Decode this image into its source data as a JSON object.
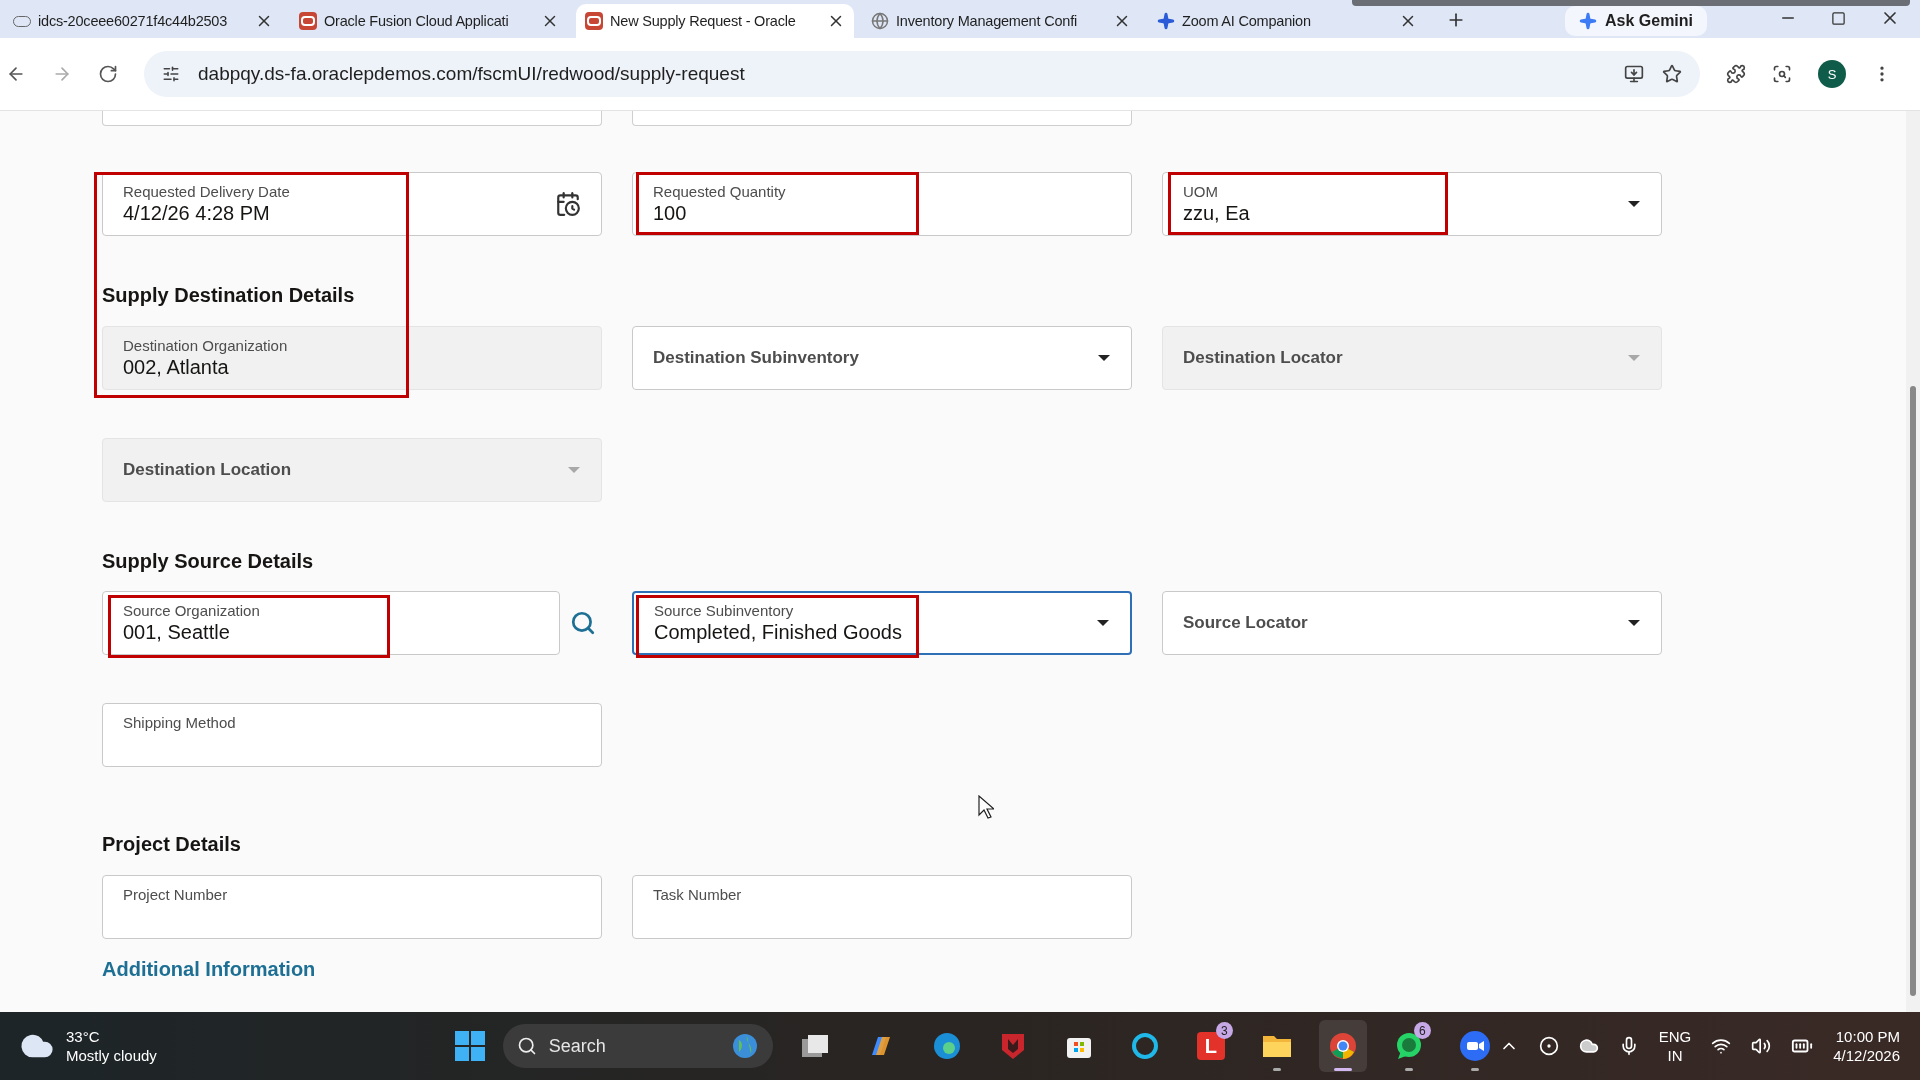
{
  "browser": {
    "tabs": [
      {
        "title": "idcs-20ceee60271f4c44b2503",
        "kind": "blank",
        "selected": false
      },
      {
        "title": "Oracle Fusion Cloud Applicati",
        "kind": "oracle",
        "selected": false
      },
      {
        "title": "New Supply Request - Oracle",
        "kind": "oracle",
        "selected": true
      },
      {
        "title": "Inventory Management Confi",
        "kind": "globe",
        "selected": false
      },
      {
        "title": "Zoom AI Companion",
        "kind": "sparkle",
        "selected": false
      }
    ],
    "gemini_label": "Ask Gemini",
    "url": "dabpqy.ds-fa.oraclepdemos.com/fscmUI/redwood/supply-request",
    "profile_initial": "S"
  },
  "form": {
    "rows": [
      {
        "kind": "cut-row"
      },
      {
        "kind": "fields",
        "fields": [
          {
            "label": "Requested Delivery Date",
            "value": "4/12/26 4:28 PM",
            "kind": "date",
            "disabled": false,
            "focused": false
          },
          {
            "label": "Requested Quantity",
            "value": "100",
            "kind": "text",
            "disabled": false,
            "focused": false
          },
          {
            "label": "UOM",
            "value": "zzu,  Ea",
            "kind": "select",
            "disabled": false,
            "focused": false
          }
        ]
      },
      {
        "kind": "heading",
        "text": "Supply Destination Details"
      },
      {
        "kind": "fields",
        "fields": [
          {
            "label": "Destination Organization",
            "value": "002, Atlanta",
            "kind": "text",
            "disabled": true,
            "focused": false
          },
          {
            "label": "Destination Subinventory",
            "kind": "select",
            "disabled": false,
            "focused": false
          },
          {
            "label": "Destination Locator",
            "kind": "select",
            "disabled": true,
            "focused": false
          }
        ]
      },
      {
        "kind": "fields",
        "fields": [
          {
            "label": "Destination Location",
            "kind": "select",
            "disabled": true,
            "focused": false
          }
        ]
      },
      {
        "kind": "heading",
        "text": "Supply Source Details"
      },
      {
        "kind": "fields",
        "fields": [
          {
            "label": "Source Organization",
            "value": "001,  Seattle",
            "kind": "lookup",
            "disabled": false,
            "focused": false
          },
          {
            "label": "Source Subinventory",
            "value": "Completed,  Finished Goods",
            "kind": "select",
            "disabled": false,
            "focused": true
          },
          {
            "label": "Source Locator",
            "kind": "select",
            "disabled": false,
            "focused": false
          }
        ]
      },
      {
        "kind": "fields",
        "fields": [
          {
            "label": "Shipping Method",
            "kind": "text",
            "disabled": false,
            "focused": false
          }
        ]
      },
      {
        "kind": "heading",
        "text": "Project Details"
      },
      {
        "kind": "fields",
        "fields": [
          {
            "label": "Project Number",
            "kind": "text",
            "disabled": false,
            "focused": false
          },
          {
            "label": "Task Number",
            "kind": "text",
            "disabled": false,
            "focused": false
          }
        ]
      },
      {
        "kind": "link",
        "text": "Additional Information"
      }
    ]
  },
  "taskbar": {
    "weather": {
      "temperature": "33°C",
      "condition": "Mostly cloudy"
    },
    "search_placeholder": "Search",
    "apps": [
      {
        "kind": "taskview",
        "running": false,
        "selected": false
      },
      {
        "kind": "copilot",
        "running": false,
        "selected": false
      },
      {
        "kind": "edge",
        "running": false,
        "selected": false
      },
      {
        "kind": "shield",
        "running": false,
        "selected": false
      },
      {
        "kind": "store",
        "running": false,
        "selected": false
      },
      {
        "kind": "ring",
        "running": false,
        "selected": false
      },
      {
        "kind": "letter",
        "label": "L",
        "badge": "3",
        "running": false,
        "selected": false
      },
      {
        "kind": "folder",
        "running": true,
        "selected": false
      },
      {
        "kind": "chrome",
        "running": true,
        "selected": true
      },
      {
        "kind": "whatsapp",
        "badge": "6",
        "running": true,
        "selected": false
      },
      {
        "kind": "zoom",
        "running": true,
        "selected": false
      }
    ],
    "language": "ENG",
    "region": "IN",
    "time": "10:00 PM",
    "date": "4/12/2026"
  }
}
